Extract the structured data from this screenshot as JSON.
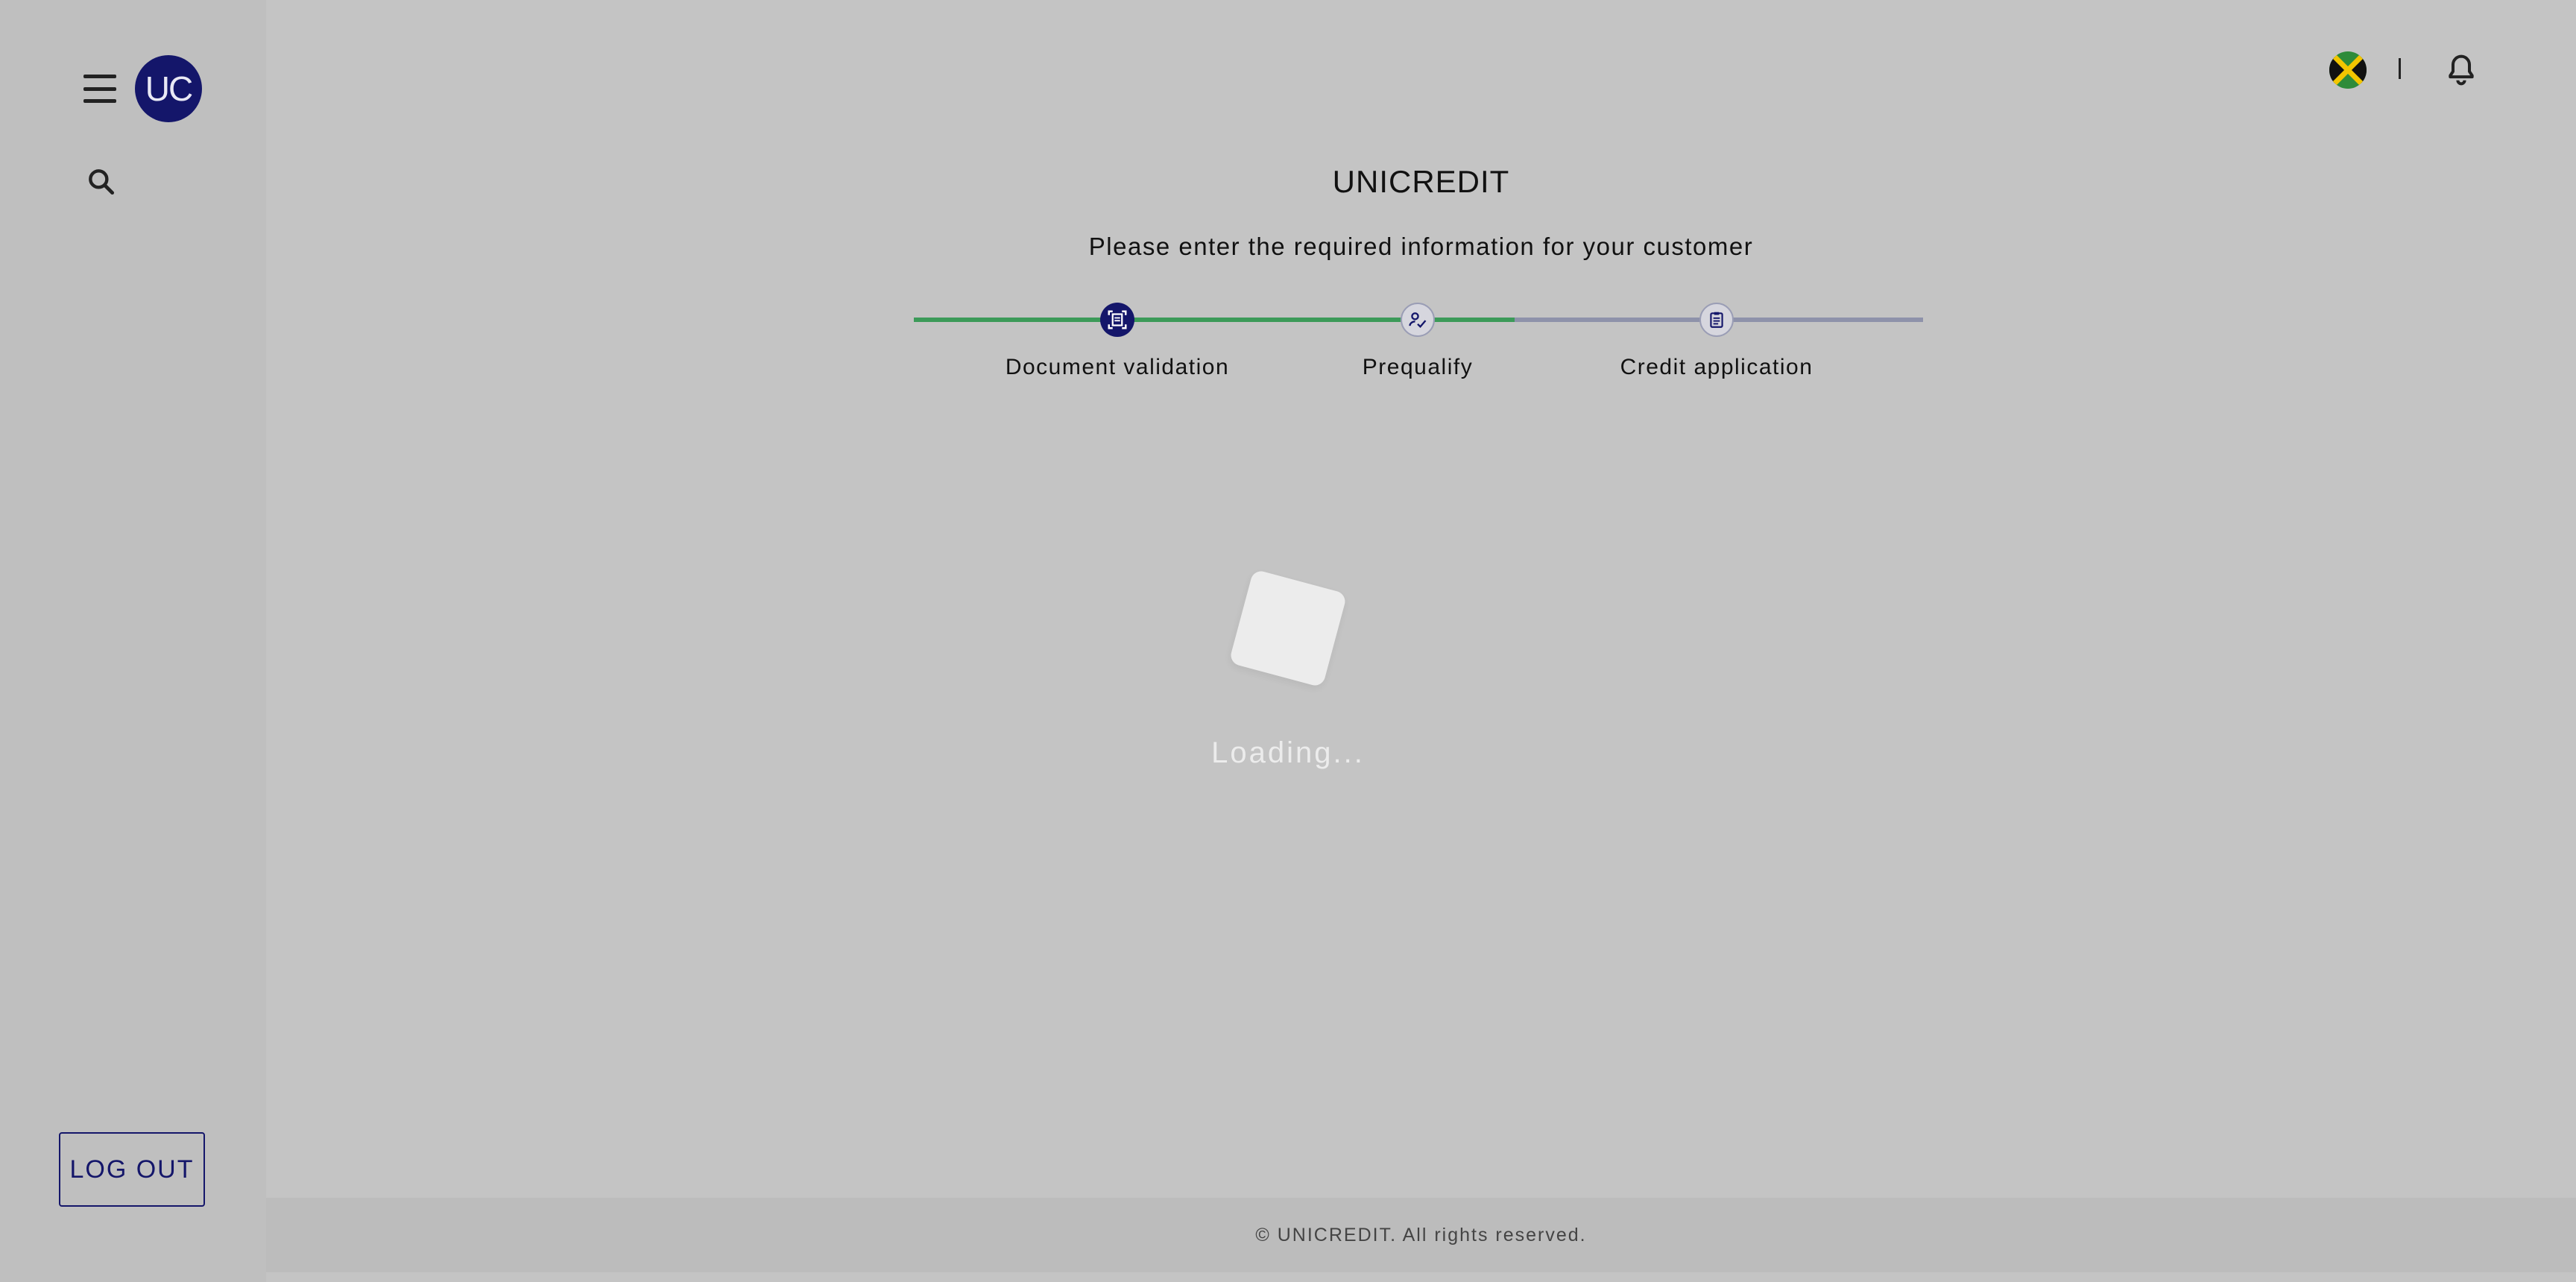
{
  "sidebar": {
    "avatar_text": "UC",
    "logout_label": "LOG OUT",
    "icons": [
      "menu-icon",
      "search-icon"
    ]
  },
  "header": {
    "flag": "jamaica-flag",
    "divider": "|",
    "notification_icon": "bell-icon"
  },
  "main": {
    "title": "UNICREDIT",
    "subtitle": "Please enter the required information for your customer",
    "steps": [
      {
        "label": "Document validation",
        "icon": "document-scan-icon",
        "state": "active"
      },
      {
        "label": "Prequalify",
        "icon": "person-check-icon",
        "state": "pending"
      },
      {
        "label": "Credit application",
        "icon": "clipboard-icon",
        "state": "pending"
      }
    ],
    "loading_text": "Loading..."
  },
  "footer": {
    "copyright": "© UNICREDIT. All rights reserved."
  },
  "colors": {
    "brand_navy": "#14166a",
    "progress_done": "#3c9a59",
    "progress_todo": "#8e92aa",
    "overlay_gray": "#c4c4c4"
  }
}
